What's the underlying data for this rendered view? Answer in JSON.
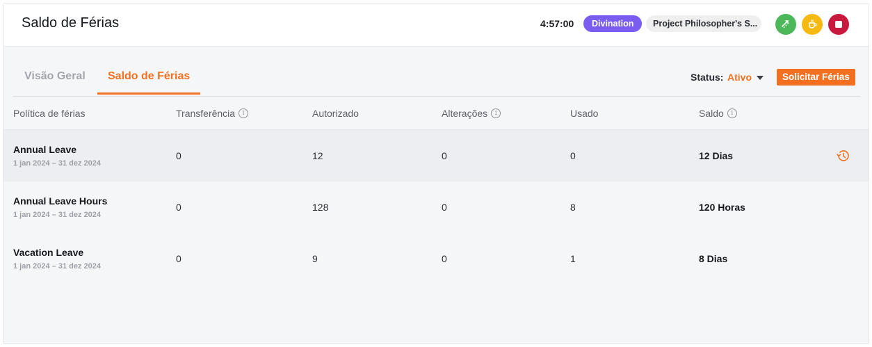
{
  "header": {
    "title": "Saldo de Férias",
    "timer": "4:57:00",
    "project": "Divination",
    "task": "Project Philosopher's S...",
    "colors": {
      "project": "#7b5cf0",
      "green": "#4cb85a",
      "yellow": "#f6b90f",
      "red": "#c8193f"
    }
  },
  "tabs": [
    {
      "label": "Visão Geral",
      "active": false
    },
    {
      "label": "Saldo de Férias",
      "active": true
    }
  ],
  "status": {
    "label": "Status",
    "value": "Ativo"
  },
  "request_button": "Solicitar Férias",
  "table": {
    "columns": [
      "Política de férias",
      "Transferência",
      "Autorizado",
      "Alterações",
      "Usado",
      "Saldo"
    ],
    "rows": [
      {
        "name": "Annual Leave",
        "dates": "1 jan 2024 – 31 dez 2024",
        "transfer": "0",
        "authorized": "12",
        "changes": "0",
        "used": "0",
        "balance": "12 Dias"
      },
      {
        "name": "Annual Leave Hours",
        "dates": "1 jan 2024 – 31 dez 2024",
        "transfer": "0",
        "authorized": "128",
        "changes": "0",
        "used": "8",
        "balance": "120 Horas"
      },
      {
        "name": "Vacation Leave",
        "dates": "1 jan 2024 – 31 dez 2024",
        "transfer": "0",
        "authorized": "9",
        "changes": "0",
        "used": "1",
        "balance": "8 Dias"
      }
    ]
  },
  "accent": "#f37021"
}
